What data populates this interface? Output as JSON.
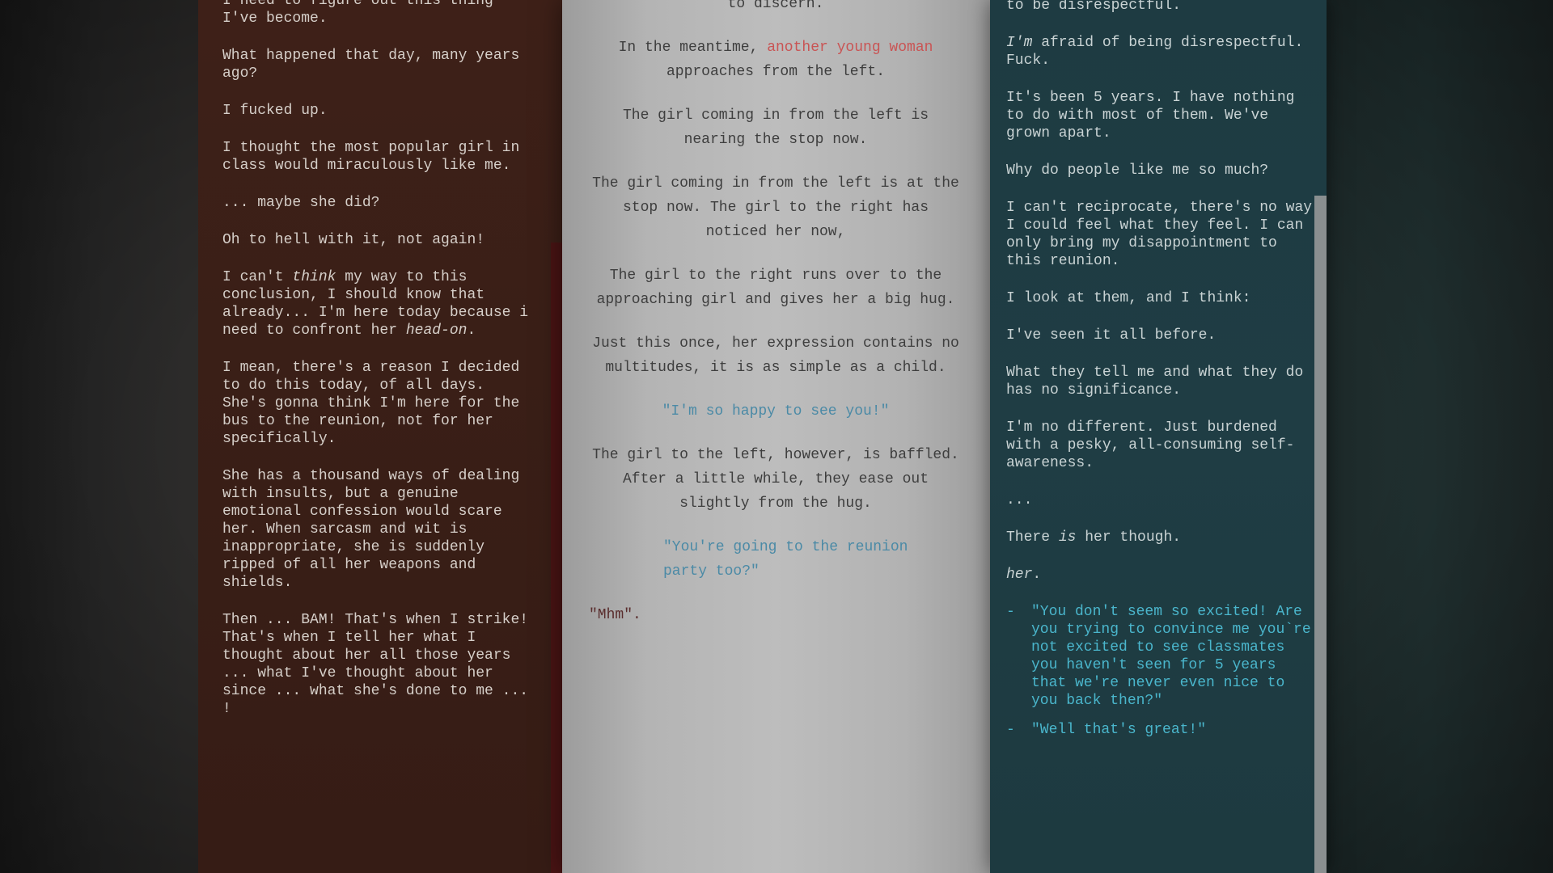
{
  "left_panel": {
    "paragraphs": [
      "I need to figure out this thing I've become.",
      "What happened that day, many years ago?",
      "I fucked up.",
      "I thought the most popular girl in class would miraculously like me.",
      "... maybe she did?",
      "Oh to hell with it, not again!"
    ],
    "p_think": {
      "pre": "I can't ",
      "em": "think",
      "post": " my way to this conclusion, I should know that already... I'm here today because i need to confront her ",
      "em2": "head-on",
      "end": "."
    },
    "paragraphs_after": [
      "I mean, there's a reason I decided to do this today, of all days. She's gonna think I'm here for the bus to the reunion, not for her specifically.",
      "She has a thousand ways of dealing with insults, but a genuine emotional confession would scare her. When sarcasm and wit is inappropriate, she is suddenly ripped of all her weapons and shields.",
      "Then ... BAM! That's when I strike! That's when I tell her what I thought about her all those years ... what I've thought about her since ... what she's done to me ... !"
    ]
  },
  "middle_panel": {
    "p0": "to discern.",
    "p1": {
      "pre": "In the meantime, ",
      "highlight": "another young woman",
      "post": " approaches from the left."
    },
    "p2": "The girl coming in from the left is nearing the stop now.",
    "p3": "The girl coming in from the left is at the stop now. The girl to the right has noticed her now,",
    "p4": "The girl to the right runs over to the approaching girl and gives her a big hug.",
    "p5": "Just this once, her expression contains no multitudes, it is as simple as a child.",
    "quote1": "\"I'm so happy to see you!\"",
    "p6": "The girl to the left, however, is baffled. After a little while, they ease out slightly from the hug.",
    "quote2": "\"You're going to the reunion party too?\"",
    "mhm": "\"Mhm\"."
  },
  "right_panel": {
    "p0": "to be disrespectful.",
    "p1": {
      "em": "I'm",
      "post": " afraid of being disrespectful. Fuck."
    },
    "p2": "It's been 5 years. I have nothing to do with most of them. We've grown apart.",
    "p3": "Why do people like me so much?",
    "p4": "I can't reciprocate, there's no way I could feel what they feel. I can only bring my disappointment to this reunion.",
    "p5": "I look at them, and I think:",
    "p6": "I've seen it all before.",
    "p7": "What they tell me and what they do has no significance.",
    "p8": "I'm no different. Just burdened with a pesky, all-consuming self-awareness.",
    "p9": "...",
    "p10": {
      "pre": "There ",
      "em": "is",
      "post": " her though."
    },
    "p11": {
      "em": "her",
      "post": "."
    },
    "choices": [
      {
        "dash": "-",
        "label": "\"You don't seem so excited! Are you trying to convince me you`re not excited to see classmates you haven't seen for 5 years that we're never even nice to you back then?\""
      },
      {
        "dash": "-",
        "label": "\"Well that's great!\""
      }
    ]
  },
  "colors": {
    "left_bg": "#3a1f17",
    "middle_bg": "#b4b4b4",
    "right_bg": "#1f3d44",
    "highlight_red": "#c95454",
    "quote_blue": "#4b8aa6",
    "choice_cyan": "#4ab6cc"
  }
}
